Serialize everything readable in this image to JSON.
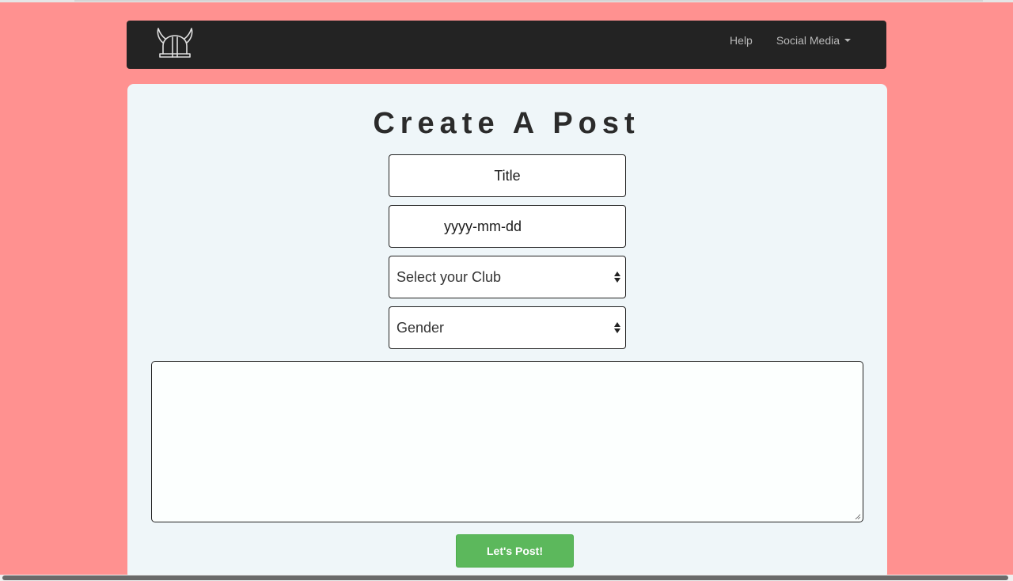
{
  "navbar": {
    "logo_icon": "viking-helmet-icon",
    "links": [
      {
        "label": "Help"
      },
      {
        "label": "Social Media",
        "has_caret": true
      }
    ]
  },
  "form": {
    "heading": "Create A Post",
    "title_placeholder": "Title",
    "date_placeholder": "yyyy-mm-dd",
    "club_select": {
      "selected": "Select your Club"
    },
    "gender_select": {
      "selected": "Gender"
    },
    "body_value": "",
    "submit_label": "Let's Post!"
  },
  "colors": {
    "page_background": "#ff9190",
    "navbar": "#232323",
    "card": "#eff6f9",
    "button": "#5cb85c"
  }
}
